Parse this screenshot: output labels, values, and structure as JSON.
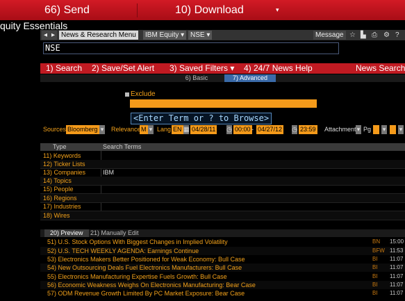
{
  "top_bar": {
    "send_label": "66) Send",
    "download_label": "10) Download",
    "dropdown_glyph": "▾"
  },
  "window_title": "quity Essentials",
  "nav": {
    "back_glyph": "◂",
    "fwd_glyph": "▸",
    "menu_label": "News & Research Menu",
    "security_label": "IBM Equity",
    "ticker_label": "NSE",
    "message_label": "Message",
    "icons": [
      "star-icon",
      "chart-icon",
      "print-icon",
      "gear-icon",
      "help-icon"
    ],
    "icon_glyphs": [
      "☆",
      "▙",
      "⎙",
      "⚙",
      "?"
    ]
  },
  "command_line": {
    "value": "NSE"
  },
  "menu_bar": {
    "search": "1) Search",
    "save_alert": "2) Save/Set Alert",
    "saved_filters": "3) Saved Filters ▾",
    "news_help": "4) 24/7 News Help",
    "title": "News Search"
  },
  "tabs": [
    {
      "label": "6) Basic",
      "active": false
    },
    {
      "label": "7) Advanced",
      "active": true
    }
  ],
  "exclude": {
    "label": "Exclude",
    "hint": "<Enter Term or ? to Browse>"
  },
  "filters": {
    "sources_label": "Sources",
    "sources_value": "Bloomberg",
    "relevance_label": "Relevance",
    "relevance_value": "M",
    "lang_label": "Lang",
    "lang_value": "EN",
    "date_from": "04/28/11",
    "time_from": "00:00",
    "dash": "-",
    "date_to": "04/27/12",
    "time_to": "23:59",
    "attachment_label": "Attachment",
    "pg_label": "Pg"
  },
  "terms_table": {
    "col_type": "Type",
    "col_terms": "Search Terms",
    "rows": [
      {
        "type": "11) Keywords",
        "value": ""
      },
      {
        "type": "12) Ticker Lists",
        "value": ""
      },
      {
        "type": "13) Companies",
        "value": "IBM"
      },
      {
        "type": "14) Topics",
        "value": ""
      },
      {
        "type": "15) People",
        "value": ""
      },
      {
        "type": "16) Regions",
        "value": ""
      },
      {
        "type": "17) Industries",
        "value": ""
      },
      {
        "type": "18) Wires",
        "value": ""
      }
    ]
  },
  "preview_tabs": [
    {
      "label": "20) Preview",
      "active": true
    },
    {
      "label": "21) Manually Edit",
      "active": false
    }
  ],
  "news": [
    {
      "num": "51)",
      "title": "U.S. Stock Options With Biggest Changes in Implied Volatility",
      "src": "BN",
      "time": "15:00"
    },
    {
      "num": "52)",
      "title": "U.S. TECH WEEKLY AGENDA: Earnings Continue",
      "src": "BFW",
      "time": "11:53"
    },
    {
      "num": "53)",
      "title": "Electronics Makers Better Positioned for Weak Economy: Bull Case",
      "src": "BI",
      "time": "11:07"
    },
    {
      "num": "54)",
      "title": "New Outsourcing Deals Fuel Electronics Manufacturers: Bull Case",
      "src": "BI",
      "time": "11:07"
    },
    {
      "num": "55)",
      "title": "Electronics Manufacturing Expertise Fuels Growth: Bull Case",
      "src": "BI",
      "time": "11:07"
    },
    {
      "num": "56)",
      "title": "Economic Weakness Weighs On Electronics Manufacturing: Bear Case",
      "src": "BI",
      "time": "11:07"
    },
    {
      "num": "57)",
      "title": "ODM Revenue Growth Limited By PC Market Exposure: Bear Case",
      "src": "BI",
      "time": "11:07"
    }
  ],
  "colors": {
    "bloomberg_red": "#c01a22",
    "amber": "#f4a21a",
    "tab_active_blue": "#3a6aa8"
  }
}
